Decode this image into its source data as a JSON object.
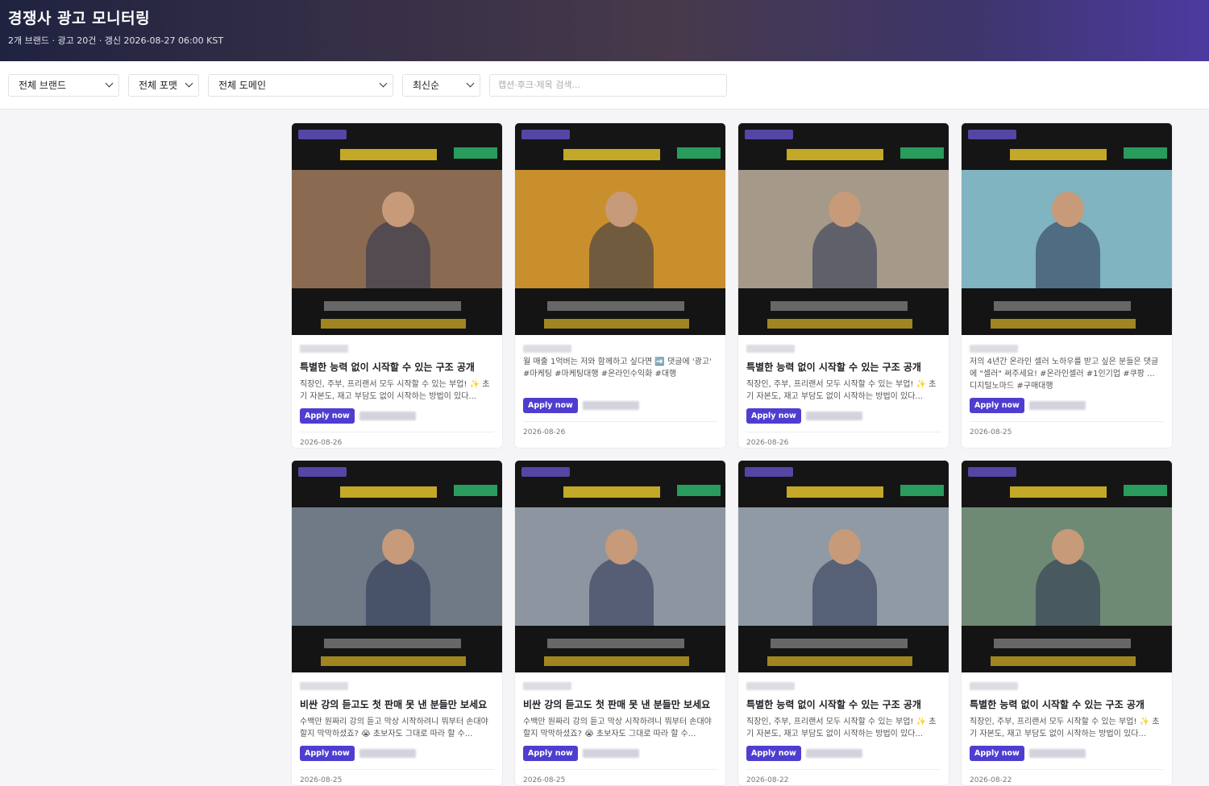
{
  "header": {
    "title": "경쟁사 광고 모니터링",
    "subtitle": "2개 브랜드 · 광고 20건 · 갱신 2026-08-27 06:00 KST"
  },
  "filters": {
    "brand": "전체 브랜드",
    "format": "전체 포맷",
    "domain": "전체 도메인",
    "sort": "최신순",
    "search_placeholder": "캡션·후크·제목 검색..."
  },
  "cards": [
    {
      "title": "특별한 능력 없이 시작할 수 있는 구조 공개",
      "caption": "직장인, 주부, 프리랜서 모두 시작할 수 있는 부업! ✨ 초기 자본도, 재고 부담도 없이 시작하는 방법이 있다...",
      "cta": "Apply now",
      "date": "2026-08-26",
      "scene": "#8a6b52"
    },
    {
      "title": "",
      "caption": "월 매출 1억버는 저와 함께하고 싶다면 ➡️ 댓글에 '광고' #마케팅 #마케팅대행 #온라인수익화 #대행",
      "cta": "Apply now",
      "date": "2026-08-26",
      "scene": "#c98f2c"
    },
    {
      "title": "특별한 능력 없이 시작할 수 있는 구조 공개",
      "caption": "직장인, 주부, 프리랜서 모두 시작할 수 있는 부업! ✨ 초기 자본도, 재고 부담도 없이 시작하는 방법이 있다...",
      "cta": "Apply now",
      "date": "2026-08-26",
      "scene": "#a59a8a"
    },
    {
      "title": "",
      "caption": "저의 4년간 온라인 셀러 노하우를 받고 싶은 분들은 댓글에 \"셀러\" 써주세요! #온라인셀러 #1인기업 #쿠팡 ... 디지털노마드 #구매대행",
      "cta": "Apply now",
      "date": "2026-08-25",
      "scene": "#7fb4c0"
    },
    {
      "title": "비싼 강의 듣고도 첫 판매 못 낸 분들만 보세요",
      "caption": "수백만 원짜리 강의 듣고 막상 시작하려니 뭐부터 손대야 할지 막막하셨죠? 😭 초보자도 그대로 따라 할 수...",
      "cta": "Apply now",
      "date": "2026-08-25",
      "scene": "#6f7a86"
    },
    {
      "title": "비싼 강의 듣고도 첫 판매 못 낸 분들만 보세요",
      "caption": "수백만 원짜리 강의 듣고 막상 시작하려니 뭐부터 손대야 할지 막막하셨죠? 😭 초보자도 그대로 따라 할 수...",
      "cta": "Apply now",
      "date": "2026-08-25",
      "scene": "#8d96a0"
    },
    {
      "title": "특별한 능력 없이 시작할 수 있는 구조 공개",
      "caption": "직장인, 주부, 프리랜서 모두 시작할 수 있는 부업! ✨ 초기 자본도, 재고 부담도 없이 시작하는 방법이 있다...",
      "cta": "Apply now",
      "date": "2026-08-22",
      "scene": "#8f9aa4"
    },
    {
      "title": "특별한 능력 없이 시작할 수 있는 구조 공개",
      "caption": "직장인, 주부, 프리랜서 모두 시작할 수 있는 부업! ✨ 초기 자본도, 재고 부담도 없이 시작하는 방법이 있다...",
      "cta": "Apply now",
      "date": "2026-08-22",
      "scene": "#6f8a74"
    }
  ]
}
